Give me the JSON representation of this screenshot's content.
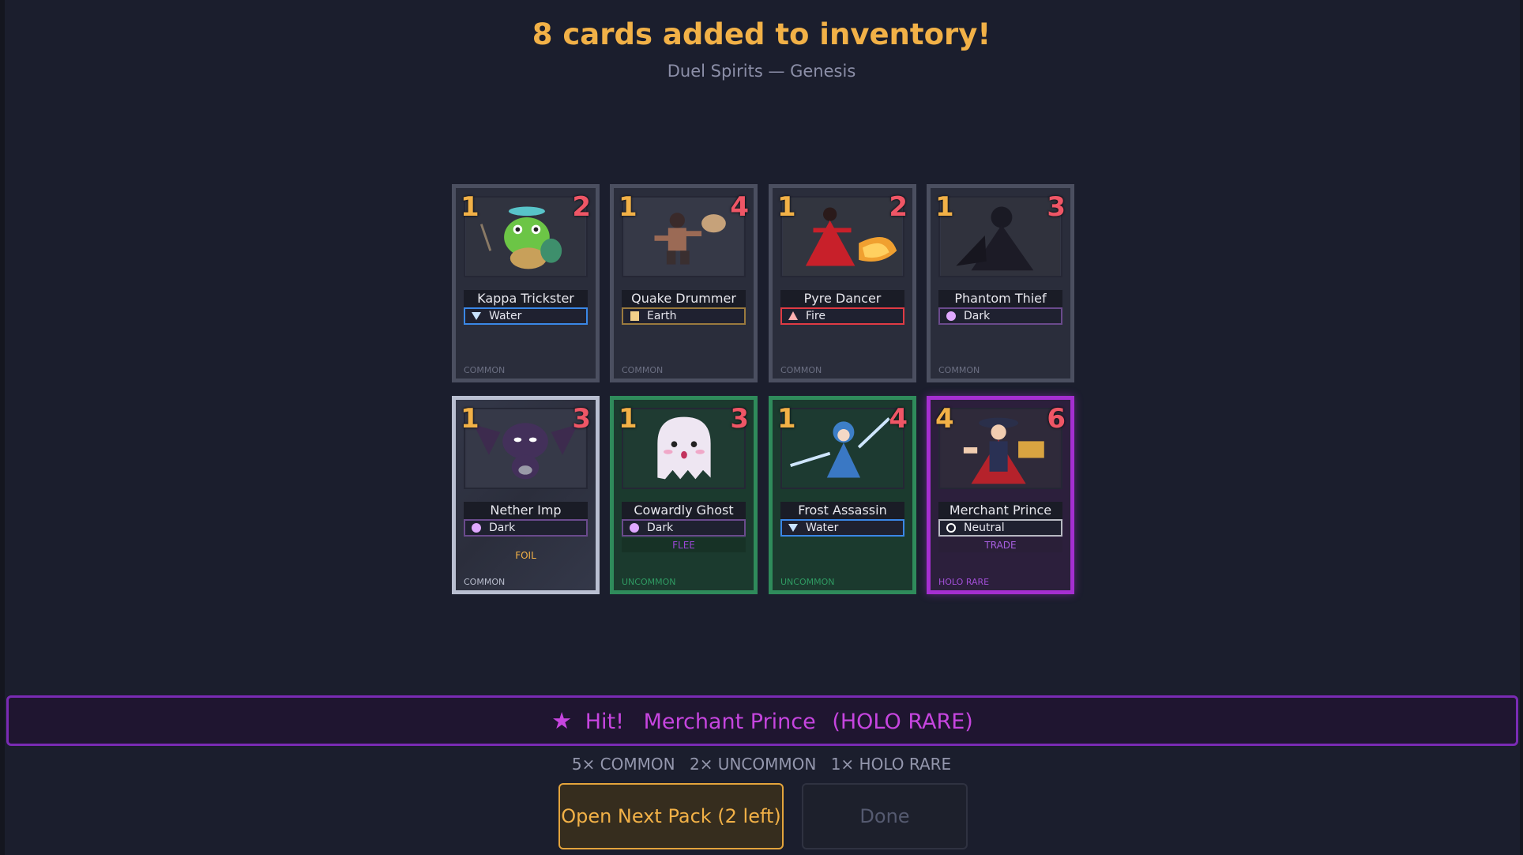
{
  "header": {
    "title": "8 cards added to inventory!",
    "subtitle": "Duel Spirits — Genesis"
  },
  "cards": [
    {
      "cost": "1",
      "power": "2",
      "name": "Kappa Trickster",
      "element": "Water",
      "element_icon": "water-triangle-icon",
      "rarity": "COMMON",
      "trait": ""
    },
    {
      "cost": "1",
      "power": "4",
      "name": "Quake Drummer",
      "element": "Earth",
      "element_icon": "earth-square-icon",
      "rarity": "COMMON",
      "trait": ""
    },
    {
      "cost": "1",
      "power": "2",
      "name": "Pyre Dancer",
      "element": "Fire",
      "element_icon": "fire-triangle-icon",
      "rarity": "COMMON",
      "trait": ""
    },
    {
      "cost": "1",
      "power": "3",
      "name": "Phantom Thief",
      "element": "Dark",
      "element_icon": "dark-circle-icon",
      "rarity": "COMMON",
      "trait": ""
    },
    {
      "cost": "1",
      "power": "3",
      "name": "Nether Imp",
      "element": "Dark",
      "element_icon": "dark-circle-icon",
      "rarity": "COMMON",
      "trait": "FOIL"
    },
    {
      "cost": "1",
      "power": "3",
      "name": "Cowardly Ghost",
      "element": "Dark",
      "element_icon": "dark-circle-icon",
      "rarity": "UNCOMMON",
      "trait": "FLEE"
    },
    {
      "cost": "1",
      "power": "4",
      "name": "Frost Assassin",
      "element": "Water",
      "element_icon": "water-triangle-icon",
      "rarity": "UNCOMMON",
      "trait": ""
    },
    {
      "cost": "4",
      "power": "6",
      "name": "Merchant Prince",
      "element": "Neutral",
      "element_icon": "neutral-ring-icon",
      "rarity": "HOLO RARE",
      "trait": "TRADE"
    }
  ],
  "hit": {
    "icon": "star-icon",
    "label": "Hit!",
    "card_name": "Merchant Prince",
    "rarity": "(HOLO RARE)"
  },
  "summary": {
    "common": "5× COMMON",
    "uncommon": "2× UNCOMMON",
    "holo_rare": "1× HOLO RARE"
  },
  "buttons": {
    "next": "Open Next Pack (2 left)",
    "done": "Done"
  },
  "colors": {
    "cost": "#f2b147",
    "power": "#ef5666",
    "holo": "#a52fd1",
    "uncommon": "#2f8b5b"
  }
}
